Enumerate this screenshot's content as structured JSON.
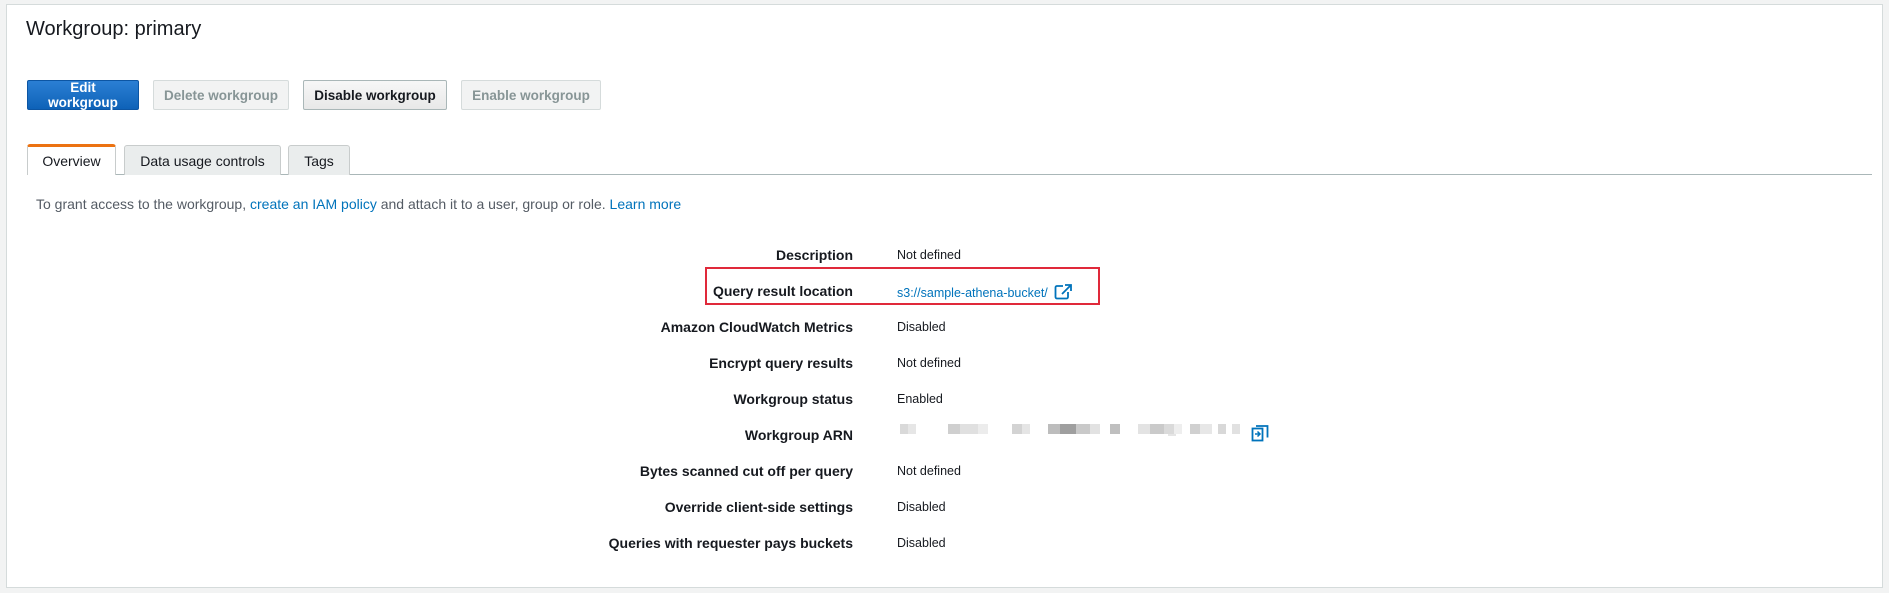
{
  "page": {
    "title": "Workgroup: primary"
  },
  "toolbar": {
    "edit_label": "Edit workgroup",
    "delete_label": "Delete workgroup",
    "disable_label": "Disable workgroup",
    "enable_label": "Enable workgroup"
  },
  "tabs": [
    {
      "label": "Overview",
      "active": true
    },
    {
      "label": "Data usage controls",
      "active": false
    },
    {
      "label": "Tags",
      "active": false
    }
  ],
  "intro": {
    "prefix": "To grant access to the workgroup, ",
    "policy_link": "create an IAM policy",
    "middle": " and attach it to a user, group or role. ",
    "learn_more": "Learn more"
  },
  "details": [
    {
      "label": "Description",
      "value": "Not defined"
    },
    {
      "label": "Query result location",
      "value": "s3://sample-athena-bucket/",
      "icon": "external-link-icon"
    },
    {
      "label": "Amazon CloudWatch Metrics",
      "value": "Disabled"
    },
    {
      "label": "Encrypt query results",
      "value": "Not defined"
    },
    {
      "label": "Workgroup status",
      "value": "Enabled"
    },
    {
      "label": "Workgroup ARN",
      "value": "",
      "icon": "copy-icon"
    },
    {
      "label": "Bytes scanned cut off per query",
      "value": "Not defined"
    },
    {
      "label": "Override client-side settings",
      "value": "Disabled"
    },
    {
      "label": "Queries with requester pays buckets",
      "value": "Disabled"
    }
  ],
  "colors": {
    "primary": "#0e62b8",
    "link": "#0073bb",
    "tab_accent": "#ec7211",
    "highlight": "#e0293a"
  }
}
